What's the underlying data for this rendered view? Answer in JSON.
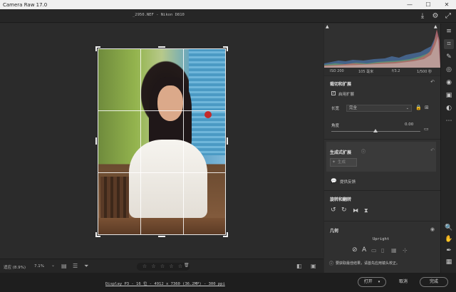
{
  "app": {
    "title": "Camera Raw 17.0"
  },
  "header": {
    "filename": "_2950.NEF  -  Nikon D810"
  },
  "histogram": {
    "iso": "ISO 200",
    "focal": "105 毫米",
    "aperture": "f/3.2",
    "shutter": "1/500 秒"
  },
  "crop_panel": {
    "title": "裁切和扩展",
    "enable_expand_label": "启用扩展",
    "enable_expand_checked": true,
    "aspect_label": "长宽",
    "aspect_value": "完全",
    "angle_label": "角度",
    "angle_value": "0.00"
  },
  "generative_panel": {
    "title": "生成式扩展",
    "generate_label": "生成",
    "feedback_label": "提供反馈"
  },
  "rotate_panel": {
    "title": "旋转和翻转"
  },
  "geometry_panel": {
    "title": "几何",
    "upright_label": "Upright",
    "hint": "要获取最佳结果，请首先应用镜头校正。"
  },
  "bottom_bar": {
    "zoom_label": "适应 (8.9%)",
    "zoom_value": "7.1%",
    "stars": "☆ ☆ ☆ ☆ ☆"
  },
  "footer": {
    "info": "Display P3 - 16 位 - 4912 x 7360 (36.2MP) - 300 ppi",
    "open_label": "打开",
    "cancel_label": "取消",
    "done_label": "完成"
  },
  "window_controls": {
    "minimize": "—",
    "maximize": "☐",
    "close": "✕"
  },
  "colors": {
    "panel_bg": "#303030",
    "canvas_bg": "#2b2b2b",
    "accent": "#ffffff"
  }
}
